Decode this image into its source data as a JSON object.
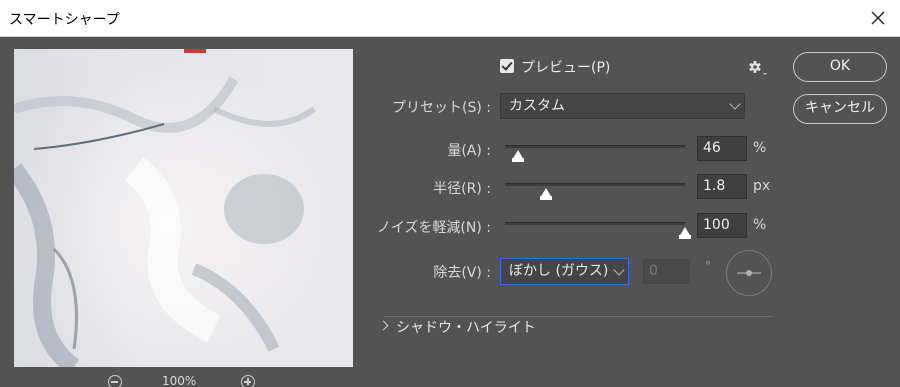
{
  "window": {
    "title": "スマートシャープ"
  },
  "buttons": {
    "ok": "OK",
    "cancel": "キャンセル"
  },
  "preview": {
    "label": "プレビュー(P)",
    "checked": true
  },
  "zoom": {
    "level": "100%"
  },
  "preset": {
    "label": "プリセット(S) :",
    "value": "カスタム"
  },
  "amount": {
    "label": "量(A) :",
    "value": "46",
    "unit": "%",
    "slider_fraction": 0.07
  },
  "radius": {
    "label": "半径(R) :",
    "value": "1.8",
    "unit": "px",
    "slider_fraction": 0.23
  },
  "noise": {
    "label": "ノイズを軽減(N) :",
    "value": "100",
    "unit": "%",
    "slider_fraction": 1.0
  },
  "remove": {
    "label": "除去(V) :",
    "value": "ぼかし (ガウス)",
    "angle": "0",
    "angle_unit": "°"
  },
  "shadow_section": {
    "label": "シャドウ・ハイライト"
  },
  "colors": {
    "panel": "#535353",
    "titlebar": "#ffffff",
    "field": "#3f3f3f",
    "focus": "#2e6ee6"
  }
}
